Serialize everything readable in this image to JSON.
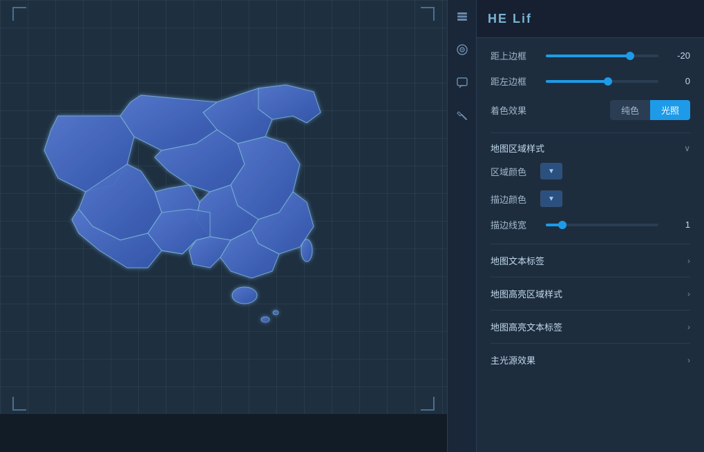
{
  "header": {
    "title": "HE Lif"
  },
  "controls": {
    "top_margin_label": "距上边框",
    "top_margin_value": "-20",
    "top_margin_percent": 75,
    "left_margin_label": "距左边框",
    "left_margin_value": "0",
    "left_margin_percent": 55,
    "color_effect_label": "着色效果",
    "color_effect_options": [
      "纯色",
      "光照"
    ],
    "color_effect_active": "光照",
    "map_area_style_label": "地图区域样式",
    "region_color_label": "区域颜色",
    "stroke_color_label": "描边颜色",
    "stroke_width_label": "描边线宽",
    "stroke_width_value": "1",
    "stroke_width_percent": 15
  },
  "sections": [
    {
      "label": "地图文本标签",
      "has_arrow": true
    },
    {
      "label": "地图高亮区域样式",
      "has_arrow": true
    },
    {
      "label": "地图高亮文本标签",
      "has_arrow": true
    },
    {
      "label": "主光源效果",
      "has_arrow": true
    }
  ],
  "sidebar_icons": [
    {
      "name": "layers-icon",
      "glyph": "⊞"
    },
    {
      "name": "target-icon",
      "glyph": "◎"
    },
    {
      "name": "chat-icon",
      "glyph": "☐"
    },
    {
      "name": "tools-icon",
      "glyph": "✂"
    }
  ],
  "colors": {
    "accent": "#1e9be8",
    "panel_bg": "#1e2d3e",
    "canvas_bg": "#1e3040"
  }
}
